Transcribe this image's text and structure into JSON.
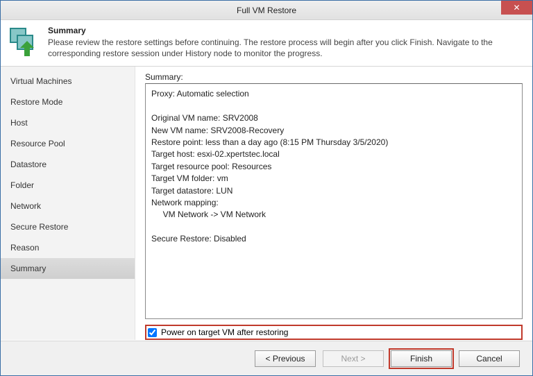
{
  "window": {
    "title": "Full VM Restore"
  },
  "header": {
    "heading": "Summary",
    "description": "Please review the restore settings before continuing. The restore process will begin after you click Finish. Navigate to the corresponding restore session under History node to monitor the progress."
  },
  "sidebar": {
    "items": [
      {
        "label": "Virtual Machines"
      },
      {
        "label": "Restore Mode"
      },
      {
        "label": "Host"
      },
      {
        "label": "Resource Pool"
      },
      {
        "label": "Datastore"
      },
      {
        "label": "Folder"
      },
      {
        "label": "Network"
      },
      {
        "label": "Secure Restore"
      },
      {
        "label": "Reason"
      },
      {
        "label": "Summary"
      }
    ],
    "selected_index": 9
  },
  "pane": {
    "label": "Summary:",
    "summary_text": "Proxy: Automatic selection\n\nOriginal VM name: SRV2008\nNew VM name: SRV2008-Recovery\nRestore point: less than a day ago (8:15 PM Thursday 3/5/2020)\nTarget host: esxi-02.xpertstec.local\nTarget resource pool: Resources\nTarget VM folder: vm\nTarget datastore: LUN\nNetwork mapping:\n     VM Network -> VM Network\n\nSecure Restore: Disabled",
    "checkbox": {
      "label": "Power on target VM after restoring",
      "checked": true
    }
  },
  "footer": {
    "previous": "< Previous",
    "next": "Next >",
    "finish": "Finish",
    "cancel": "Cancel"
  }
}
